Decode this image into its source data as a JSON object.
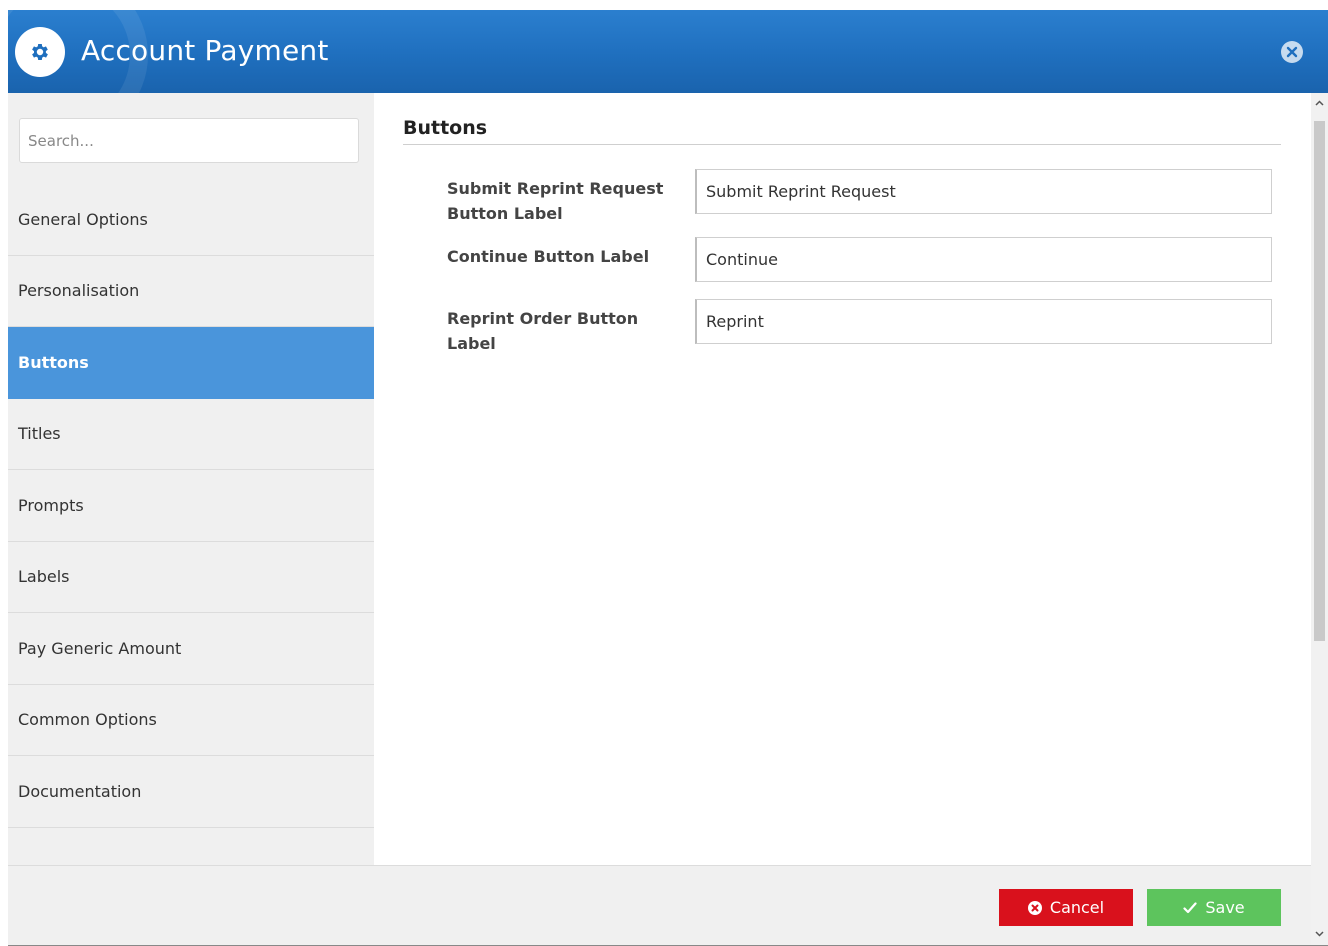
{
  "dialog": {
    "title": "Account Payment",
    "icon": "gear-icon",
    "close_icon": "close-circle-icon"
  },
  "search": {
    "placeholder": "Search...",
    "value": ""
  },
  "sidebar": {
    "items": [
      {
        "label": "General Options",
        "active": false
      },
      {
        "label": "Personalisation",
        "active": false
      },
      {
        "label": "Buttons",
        "active": true
      },
      {
        "label": "Titles",
        "active": false
      },
      {
        "label": "Prompts",
        "active": false
      },
      {
        "label": "Labels",
        "active": false
      },
      {
        "label": "Pay Generic Amount",
        "active": false
      },
      {
        "label": "Common Options",
        "active": false
      },
      {
        "label": "Documentation",
        "active": false
      }
    ]
  },
  "main": {
    "section_title": "Buttons",
    "fields": [
      {
        "label": "Submit Reprint Request Button Label",
        "value": "Submit Reprint Request"
      },
      {
        "label": "Continue Button Label",
        "value": "Continue"
      },
      {
        "label": "Reprint Order Button Label",
        "value": "Reprint"
      }
    ]
  },
  "footer": {
    "cancel_label": "Cancel",
    "save_label": "Save"
  },
  "colors": {
    "header": "#1f6fbe",
    "active_nav": "#4a95db",
    "cancel": "#d9111c",
    "save": "#5dc45d"
  }
}
